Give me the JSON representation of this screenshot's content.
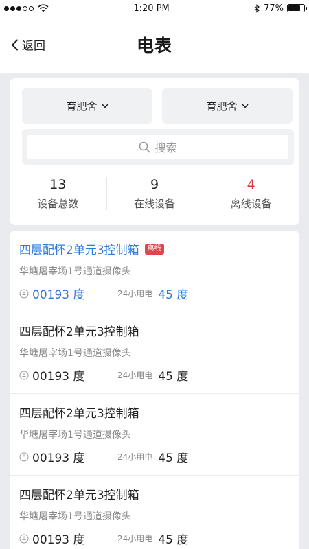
{
  "status_bar": {
    "time": "1:20 PM",
    "battery": "77%",
    "battery_level": 0.77
  },
  "nav": {
    "back_label": "返回",
    "title": "电表"
  },
  "filters": {
    "dropdown_left": "育肥舍",
    "dropdown_right": "育肥舍",
    "search_placeholder": "搜索"
  },
  "stats": [
    {
      "value": "13",
      "label": "设备总数"
    },
    {
      "value": "9",
      "label": "在线设备"
    },
    {
      "value": "4",
      "label": "离线设备"
    }
  ],
  "colors": {
    "accent": "#2f7bdc",
    "offline": "#d9363e"
  },
  "devices": [
    {
      "name": "四层配怀2单元3控制箱",
      "badge": "离线",
      "location": "华塘屠宰场1号通道摄像头",
      "reading": "00193 度",
      "usage_label": "24小用电",
      "usage": "45 度",
      "highlighted": true
    },
    {
      "name": "四层配怀2单元3控制箱",
      "badge": "",
      "location": "华塘屠宰场1号通道摄像头",
      "reading": "00193 度",
      "usage_label": "24小用电",
      "usage": "45 度",
      "highlighted": false
    },
    {
      "name": "四层配怀2单元3控制箱",
      "badge": "",
      "location": "华塘屠宰场1号通道摄像头",
      "reading": "00193 度",
      "usage_label": "24小用电",
      "usage": "45 度",
      "highlighted": false
    },
    {
      "name": "四层配怀2单元3控制箱",
      "badge": "",
      "location": "华塘屠宰场1号通道摄像头",
      "reading": "00193 度",
      "usage_label": "24小用电",
      "usage": "45 度",
      "highlighted": false
    }
  ]
}
